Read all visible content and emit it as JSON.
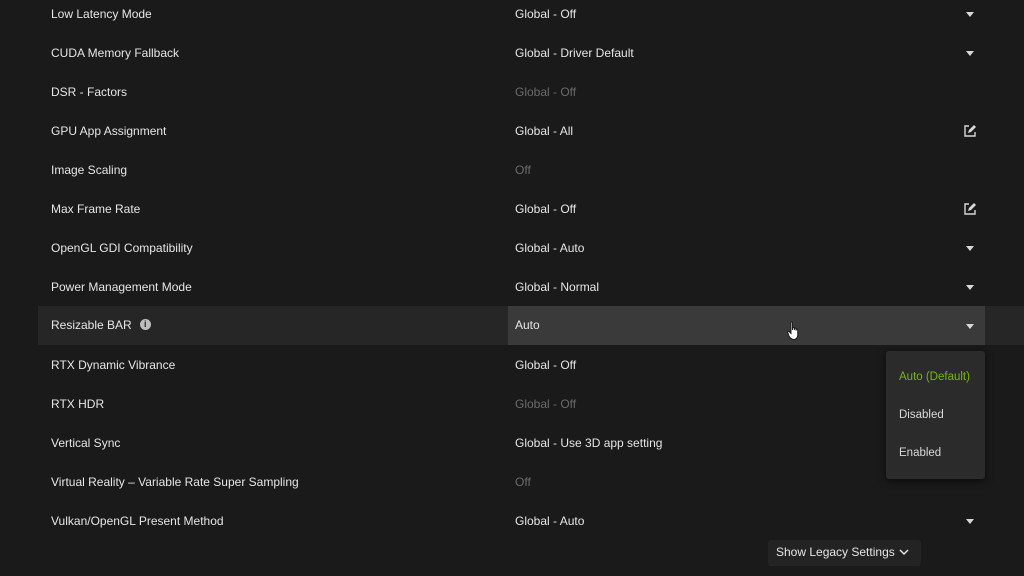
{
  "settings": [
    {
      "name": "Low Latency Mode",
      "value": "Global - Off",
      "control": "chevron-down-icon",
      "dim": false
    },
    {
      "name": "CUDA Memory Fallback",
      "value": "Global - Driver Default",
      "control": "chevron-down-icon",
      "dim": false
    },
    {
      "name": "DSR - Factors",
      "value": "Global - Off",
      "control": "",
      "dim": true
    },
    {
      "name": "GPU App Assignment",
      "value": "Global - All",
      "control": "edit-icon",
      "dim": false
    },
    {
      "name": "Image Scaling",
      "value": "Off",
      "control": "",
      "dim": true
    },
    {
      "name": "Max Frame Rate",
      "value": "Global - Off",
      "control": "edit-icon",
      "dim": false
    },
    {
      "name": "OpenGL GDI Compatibility",
      "value": "Global - Auto",
      "control": "chevron-down-icon",
      "dim": false
    },
    {
      "name": "Power Management Mode",
      "value": "Global - Normal",
      "control": "chevron-down-icon",
      "dim": false
    },
    {
      "name": "Resizable BAR",
      "value": "Auto",
      "control": "chevron-down-icon",
      "dim": false,
      "info_icon": "info-icon",
      "active": true
    },
    {
      "name": "RTX Dynamic Vibrance",
      "value": "Global - Off",
      "control": "",
      "dim": false
    },
    {
      "name": "RTX HDR",
      "value": "Global - Off",
      "control": "",
      "dim": true
    },
    {
      "name": "Vertical Sync",
      "value": "Global - Use 3D app setting",
      "control": "",
      "dim": false
    },
    {
      "name": "Virtual Reality – Variable Rate Super Sampling",
      "value": "Off",
      "control": "",
      "dim": true
    },
    {
      "name": "Vulkan/OpenGL Present Method",
      "value": "Global - Auto",
      "control": "chevron-down-icon",
      "dim": false
    }
  ],
  "dropdown": {
    "options": [
      "Auto (Default)",
      "Disabled",
      "Enabled"
    ],
    "selected": "Auto (Default)"
  },
  "footer": {
    "legacy_label": "Show Legacy Settings",
    "legacy_icon": "chevron-down-icon"
  },
  "colors": {
    "background": "#1a1a1a",
    "active_row": "#262626",
    "active_value_box": "#3a3a3a",
    "accent": "#76b900",
    "dim_text": "#6b6b6b"
  }
}
